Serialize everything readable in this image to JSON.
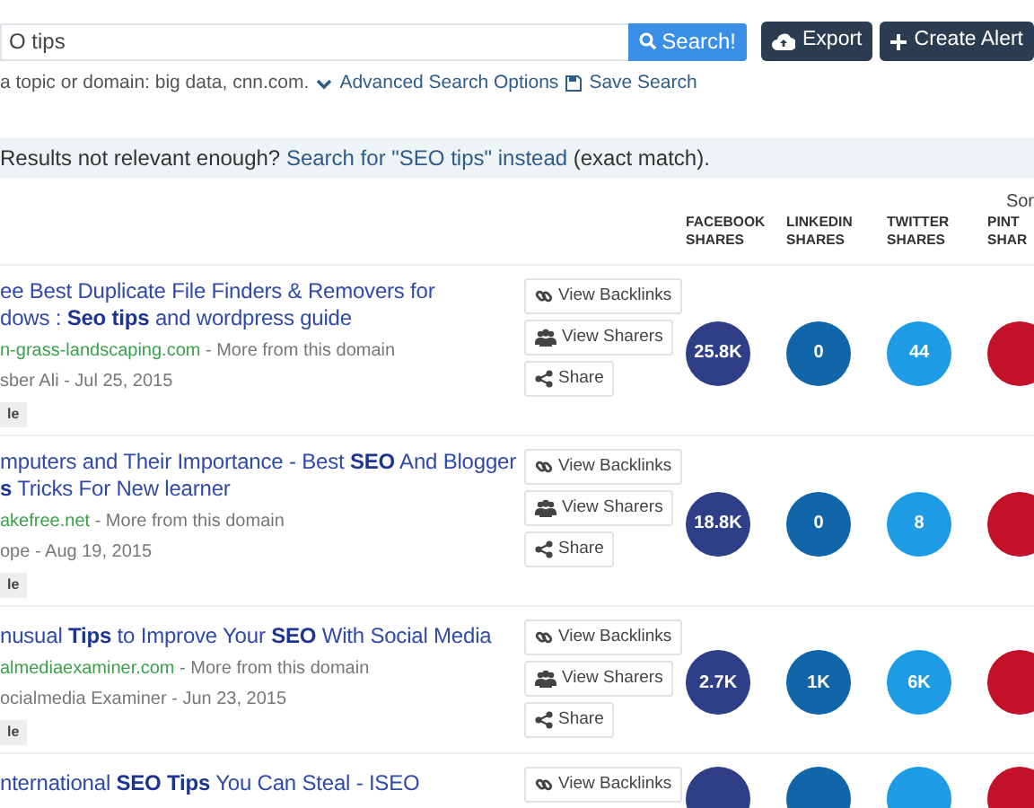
{
  "search": {
    "value": "O tips",
    "button": "Search!",
    "hint": "a topic or domain: big data, cnn.com.",
    "advanced": "Advanced Search Options",
    "save": "Save Search"
  },
  "actions": [
    {
      "kind": "export",
      "label": "Export"
    },
    {
      "kind": "alert",
      "label": "Create Alert"
    }
  ],
  "notice": {
    "text": "Results not relevant enough?",
    "link": "Search for \"SEO tips\" instead",
    "tail": "(exact match)."
  },
  "sort_label": "Sor",
  "columns": [
    {
      "lines": [
        "FACEBOOK",
        "SHARES"
      ],
      "color": "#2e3f87"
    },
    {
      "lines": [
        "LINKEDIN",
        "SHARES"
      ],
      "color": "#1066a8"
    },
    {
      "lines": [
        "TWITTER",
        "SHARES"
      ],
      "color": "#1d9be5"
    },
    {
      "lines": [
        "PINT",
        "SHAR"
      ],
      "color": "#c3112a"
    }
  ],
  "results": [
    {
      "title_lines": [
        "ee Best Duplicate File Finders & Removers for",
        "dows : **Seo tips** and wordpress guide"
      ],
      "domain": "n-grass-landscaping.com",
      "more": "- More from this domain",
      "byline": "sber Ali - Jul 25, 2015",
      "tag": "le",
      "buttons": [
        {
          "kind": "backlinks",
          "label": "View Backlinks"
        },
        {
          "kind": "sharers",
          "label": "View Sharers"
        },
        {
          "kind": "share",
          "label": "Share"
        }
      ],
      "shares": [
        "25.8K",
        "0",
        "44"
      ]
    },
    {
      "title_lines": [
        "mputers and Their Importance - Best **SEO** And Blogger",
        "**s** Tricks For New learner"
      ],
      "domain": "akefree.net",
      "more": "- More from this domain",
      "byline": "ope - Aug 19, 2015",
      "tag": "le",
      "buttons": [
        {
          "kind": "backlinks",
          "label": "View Backlinks"
        },
        {
          "kind": "sharers",
          "label": "View Sharers"
        },
        {
          "kind": "share",
          "label": "Share"
        }
      ],
      "shares": [
        "18.8K",
        "0",
        "8"
      ]
    },
    {
      "title_lines": [
        "nusual **Tips** to Improve Your **SEO** With Social Media"
      ],
      "domain": "almediaexaminer.com",
      "more": "- More from this domain",
      "byline": "ocialmedia Examiner - Jun 23, 2015",
      "tag": "le",
      "buttons": [
        {
          "kind": "backlinks",
          "label": "View Backlinks"
        },
        {
          "kind": "sharers",
          "label": "View Sharers"
        },
        {
          "kind": "share",
          "label": "Share"
        }
      ],
      "shares": [
        "2.7K",
        "1K",
        "6K"
      ]
    },
    {
      "title_lines": [
        "nternational **SEO Tips** You Can Steal - ISEO"
      ],
      "buttons": [
        {
          "kind": "backlinks",
          "label": "View Backlinks"
        }
      ]
    }
  ]
}
